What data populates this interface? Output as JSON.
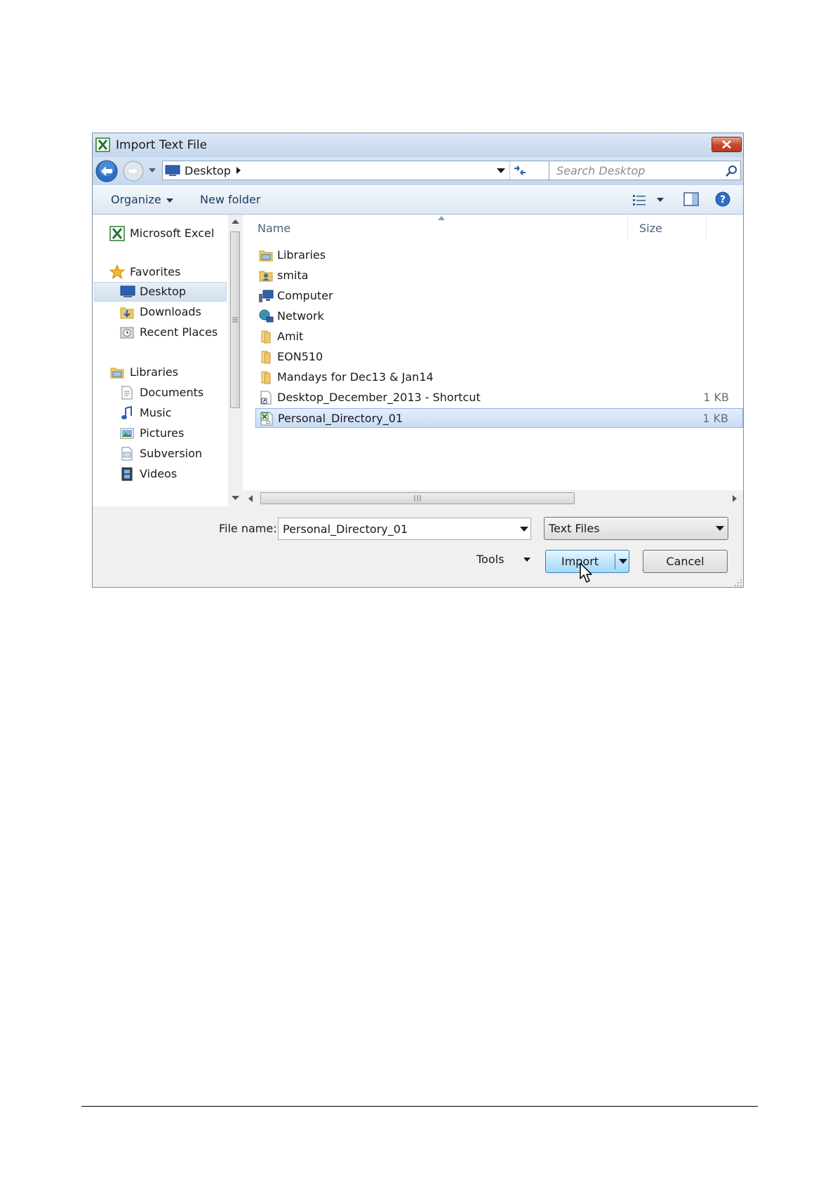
{
  "dialog": {
    "title": "Import Text File",
    "address": {
      "location": "Desktop"
    },
    "search": {
      "placeholder": "Search Desktop"
    },
    "toolbar": {
      "organize": "Organize",
      "new_folder": "New folder"
    },
    "nav": {
      "items": [
        {
          "label": "Microsoft Excel",
          "icon": "excel-icon"
        },
        {
          "label": "Favorites",
          "icon": "star-icon"
        },
        {
          "label": "Desktop",
          "icon": "desktop-icon",
          "selected": true
        },
        {
          "label": "Downloads",
          "icon": "downloads-icon"
        },
        {
          "label": "Recent Places",
          "icon": "recent-places-icon"
        },
        {
          "label": "Libraries",
          "icon": "libraries-icon"
        },
        {
          "label": "Documents",
          "icon": "documents-icon"
        },
        {
          "label": "Music",
          "icon": "music-icon"
        },
        {
          "label": "Pictures",
          "icon": "pictures-icon"
        },
        {
          "label": "Subversion",
          "icon": "subversion-icon"
        },
        {
          "label": "Videos",
          "icon": "videos-icon"
        }
      ]
    },
    "files": {
      "columns": {
        "name": "Name",
        "size": "Size"
      },
      "rows": [
        {
          "name": "Libraries",
          "size": "",
          "icon": "libraries-icon"
        },
        {
          "name": "smita",
          "size": "",
          "icon": "user-folder-icon"
        },
        {
          "name": "Computer",
          "size": "",
          "icon": "computer-icon"
        },
        {
          "name": "Network",
          "size": "",
          "icon": "network-icon"
        },
        {
          "name": "Amit",
          "size": "",
          "icon": "folder-icon"
        },
        {
          "name": "EON510",
          "size": "",
          "icon": "folder-icon"
        },
        {
          "name": "Mandays for Dec13 & Jan14",
          "size": "",
          "icon": "folder-icon"
        },
        {
          "name": "Desktop_December_2013 - Shortcut",
          "size": "1 KB",
          "icon": "shortcut-icon"
        },
        {
          "name": "Personal_Directory_01",
          "size": "1 KB",
          "icon": "excel-text-file-icon",
          "selected": true
        }
      ]
    },
    "bottom": {
      "file_name_label": "File name:",
      "file_name_value": "Personal_Directory_01",
      "file_type": "Text Files",
      "tools": "Tools",
      "import": "Import",
      "cancel": "Cancel"
    },
    "colors": {
      "selection": "#cde0f7",
      "accent": "#3c7fb1",
      "close": "#c9442c"
    }
  }
}
